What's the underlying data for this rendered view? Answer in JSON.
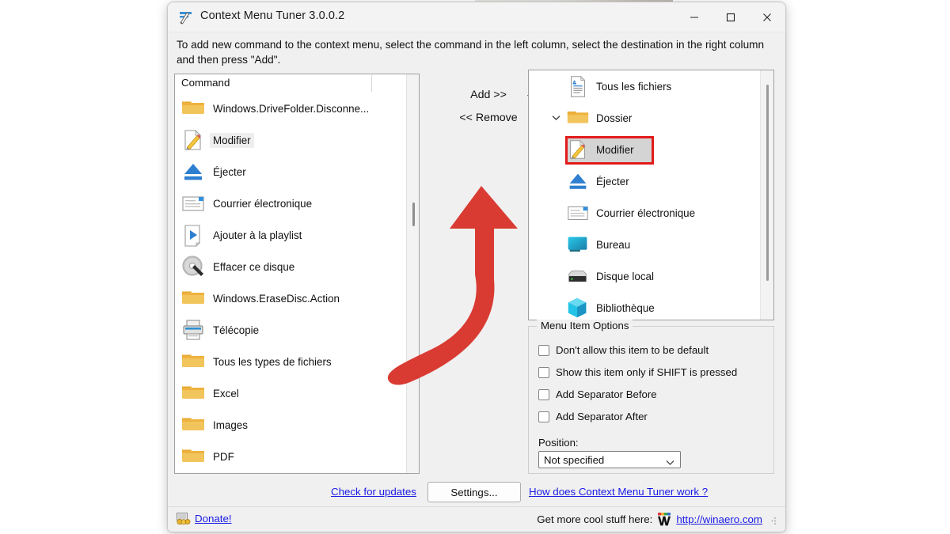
{
  "window": {
    "title": "Context Menu Tuner 3.0.0.2",
    "icon": "app-icon",
    "controls": {
      "minimize": "–",
      "maximize": "□",
      "close": "✕"
    }
  },
  "instruction": "To add new command to the context menu, select the command in the left column, select the destination in the right column and then press \"Add\".",
  "left_panel": {
    "column_header": "Command",
    "items": [
      {
        "label": "Windows.DriveFolder.Disconne...",
        "icon": "folder-icon",
        "selected": false
      },
      {
        "label": "Modifier",
        "icon": "edit-document-icon",
        "selected": true
      },
      {
        "label": "Éjecter",
        "icon": "eject-icon",
        "selected": false
      },
      {
        "label": "Courrier électronique",
        "icon": "mail-icon",
        "selected": false
      },
      {
        "label": "Ajouter à la playlist",
        "icon": "play-document-icon",
        "selected": false
      },
      {
        "label": "Effacer ce disque",
        "icon": "disc-erase-icon",
        "selected": false
      },
      {
        "label": "Windows.EraseDisc.Action",
        "icon": "folder-icon",
        "selected": false
      },
      {
        "label": "Télécopie",
        "icon": "printer-icon",
        "selected": false
      },
      {
        "label": "Tous les types de fichiers",
        "icon": "folder-icon",
        "selected": false
      },
      {
        "label": "Excel",
        "icon": "folder-icon",
        "selected": false
      },
      {
        "label": "Images",
        "icon": "folder-icon",
        "selected": false
      },
      {
        "label": "PDF",
        "icon": "folder-icon",
        "selected": false
      }
    ]
  },
  "center": {
    "add_label": "Add >>",
    "remove_label": "<< Remove",
    "dropdown_icon": "caret-down-icon",
    "arrow_color": "#d93b33"
  },
  "right_panel": {
    "items": [
      {
        "label": "Tous les fichiers",
        "icon": "text-document-icon",
        "indent": 1,
        "chevron": "",
        "selected": false
      },
      {
        "label": "Dossier",
        "icon": "folder-icon",
        "indent": 1,
        "chevron": "⌄",
        "selected": false
      },
      {
        "label": "Modifier",
        "icon": "edit-document-icon",
        "indent": 2,
        "chevron": "",
        "selected": true
      },
      {
        "label": "Éjecter",
        "icon": "eject-icon",
        "indent": 2,
        "chevron": "",
        "selected": false
      },
      {
        "label": "Courrier électronique",
        "icon": "mail-icon",
        "indent": 2,
        "chevron": "",
        "selected": false
      },
      {
        "label": "Bureau",
        "icon": "desktop-icon",
        "indent": 1,
        "chevron": "",
        "selected": false
      },
      {
        "label": "Disque local",
        "icon": "harddisk-icon",
        "indent": 1,
        "chevron": "",
        "selected": false
      },
      {
        "label": "Bibliothèque",
        "icon": "library-icon",
        "indent": 1,
        "chevron": "",
        "selected": false
      }
    ],
    "selection_highlight_color": "#e21b1b"
  },
  "menu_item_options": {
    "title": "Menu Item Options",
    "checkboxes": [
      {
        "label": "Don't allow this item to be default",
        "checked": false
      },
      {
        "label": "Show this item only if SHIFT is pressed",
        "checked": false
      },
      {
        "label": "Add Separator Before",
        "checked": false
      },
      {
        "label": "Add Separator After",
        "checked": false
      }
    ],
    "position_label": "Position:",
    "position_value": "Not specified"
  },
  "actions": {
    "check_updates": "Check for updates",
    "settings": "Settings...",
    "how_does_it_work": "How does Context Menu Tuner work ?"
  },
  "status_bar": {
    "donate": "Donate!",
    "more_text": "Get more cool stuff here:",
    "site_url": "http://winaero.com",
    "logo": "winaero-w-logo"
  }
}
